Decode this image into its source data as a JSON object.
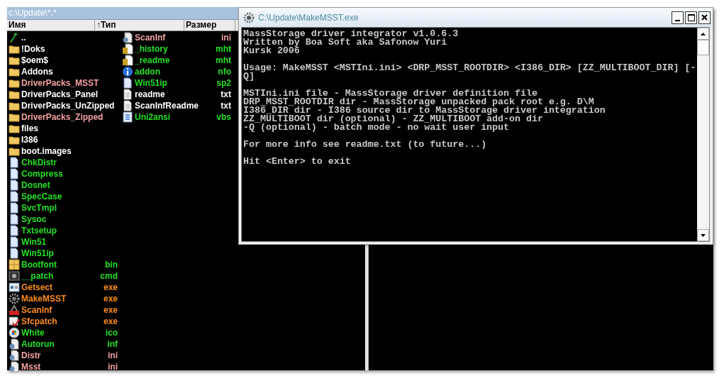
{
  "left_panel": {
    "path": "c:\\Update\\*.*",
    "columns": [
      "Имя",
      "↑Тип",
      "Размер"
    ],
    "file_columns": [
      [
        {
          "name": "..",
          "kind": "up",
          "color": "#ffffff"
        },
        {
          "name": "!Doks",
          "kind": "folder",
          "color": "#ffffff"
        },
        {
          "name": "$oem$",
          "kind": "folder",
          "color": "#ffffff"
        },
        {
          "name": "Addons",
          "kind": "folder",
          "color": "#ffffff"
        },
        {
          "name": "DriverPacks_MSST",
          "kind": "folder",
          "color": "#f4a0a0"
        },
        {
          "name": "DriverPacks_Panel",
          "kind": "folder",
          "color": "#ffffff"
        },
        {
          "name": "DriverPacks_UnZipped",
          "kind": "folder",
          "color": "#ffffff"
        },
        {
          "name": "DriverPacks_Zipped",
          "kind": "folder",
          "color": "#f4a0a0"
        },
        {
          "name": "files",
          "kind": "folder",
          "color": "#ffffff"
        },
        {
          "name": "I386",
          "kind": "folder",
          "color": "#ffffff"
        },
        {
          "name": "boot.images",
          "kind": "folder",
          "color": "#ffffff"
        },
        {
          "name": "ChkDistr",
          "kind": "doc",
          "color": "#22e022"
        },
        {
          "name": "Compress",
          "kind": "doc",
          "color": "#22e022"
        },
        {
          "name": "Dosnet",
          "kind": "doc",
          "color": "#22e022"
        },
        {
          "name": "SpecCase",
          "kind": "doc",
          "color": "#22e022"
        },
        {
          "name": "SvcTmpl",
          "kind": "doc",
          "color": "#22e022"
        },
        {
          "name": "Sysoc",
          "kind": "doc",
          "color": "#22e022"
        },
        {
          "name": "Txtsetup",
          "kind": "doc",
          "color": "#22e022"
        },
        {
          "name": "Win51",
          "kind": "doc",
          "color": "#22e022"
        },
        {
          "name": "Win51ip",
          "kind": "doc",
          "color": "#22e022"
        },
        {
          "name": "Bootfont",
          "ext": "bin",
          "kind": "package",
          "color": "#22e022"
        },
        {
          "name": "__patch",
          "ext": "cmd",
          "kind": "console",
          "color": "#22e022"
        },
        {
          "name": "Getsect",
          "ext": "exe",
          "kind": "app",
          "color": "#ff8c1a"
        },
        {
          "name": "MakeMSST",
          "ext": "exe",
          "kind": "gear",
          "color": "#ff8c1a"
        },
        {
          "name": "ScanInf",
          "ext": "exe",
          "kind": "tool",
          "color": "#ff8c1a"
        },
        {
          "name": "Sfcpatch",
          "ext": "exe",
          "kind": "check",
          "color": "#ff8c1a"
        },
        {
          "name": "White",
          "ext": "ico",
          "kind": "globe",
          "color": "#22e022"
        },
        {
          "name": "Autorun",
          "ext": "inf",
          "kind": "config",
          "color": "#22e022"
        },
        {
          "name": "Distr",
          "ext": "ini",
          "kind": "config",
          "color": "#f4a0a0"
        },
        {
          "name": "Msst",
          "ext": "ini",
          "kind": "config",
          "color": "#f4a0a0"
        }
      ],
      [
        {
          "name": "ScanInf",
          "ext": "ini",
          "kind": "config",
          "color": "#f4a0a0"
        },
        {
          "name": "_history",
          "ext": "mht",
          "kind": "web",
          "color": "#22e022"
        },
        {
          "name": "_readme",
          "ext": "mht",
          "kind": "web",
          "color": "#22e022"
        },
        {
          "name": "addon",
          "ext": "nfo",
          "kind": "info",
          "color": "#22e022"
        },
        {
          "name": "Win51ip",
          "ext": "sp2",
          "kind": "doc",
          "color": "#22e022"
        },
        {
          "name": "readme",
          "ext": "txt",
          "kind": "text",
          "color": "#ffffff"
        },
        {
          "name": "ScanInfReadme",
          "ext": "txt",
          "kind": "text",
          "color": "#ffffff"
        },
        {
          "name": "Uni2ansi",
          "ext": "vbs",
          "kind": "script",
          "color": "#22e022"
        }
      ]
    ]
  },
  "console_window": {
    "title": "C:\\Update\\MakeMSST.exe",
    "paragraphs": [
      [
        "MassStorage driver integrator v1.0.6.3",
        "Written by Boa Soft aka Safonow Yuri",
        "Kursk 2006"
      ],
      [
        "Usage: MakeMSST <MSTIni.ini> <DRP_MSST_ROOTDIR> <I386_DIR> [ZZ_MULTIBOOT_DIR] [-",
        "Q]"
      ],
      [
        "MSTIni.ini file - MassStorage driver definition file",
        "DRP_MSST_ROOTDIR dir - MassStorage unpacked pack root e.g. D\\M",
        "I386_DIR dir - I386 source dir to MassStorage driver integration",
        "ZZ_MULTIBOOT dir (optional) - ZZ_MULTIBOOT add-on dir",
        "-Q (optional) - batch mode - no wait user input"
      ],
      [
        "For more info see readme.txt (to future...)"
      ],
      [
        "Hit <Enter> to exit"
      ]
    ]
  }
}
